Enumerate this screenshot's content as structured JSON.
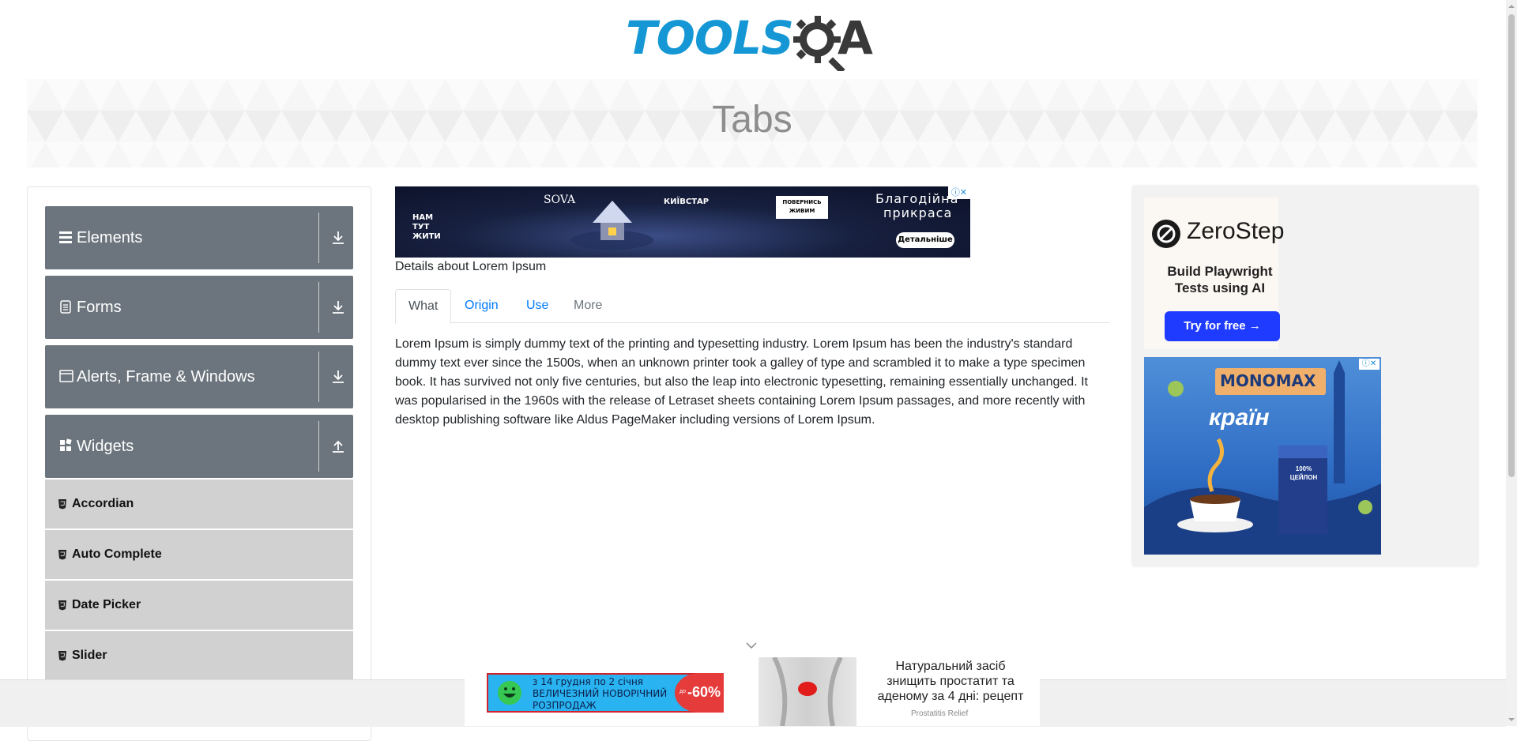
{
  "header": {
    "logo_text": "TOOLS",
    "logo_a": "A"
  },
  "banner": {
    "title": "Tabs"
  },
  "sidebar": {
    "groups": [
      {
        "label": "Elements",
        "icon": "hamburger-icon",
        "state": "collapsed"
      },
      {
        "label": "Forms",
        "icon": "form-icon",
        "state": "collapsed"
      },
      {
        "label": "Alerts, Frame & Windows",
        "icon": "window-icon",
        "state": "collapsed"
      },
      {
        "label": "Widgets",
        "icon": "widgets-icon",
        "state": "expanded"
      }
    ],
    "widgets_items": [
      {
        "label": "Accordian"
      },
      {
        "label": "Auto Complete"
      },
      {
        "label": "Date Picker"
      },
      {
        "label": "Slider"
      }
    ]
  },
  "ad_top": {
    "brand1": "SOVA",
    "brand2": "КИЇВСТАР",
    "badge": "ПОВЕРНИСЬ ЖИВИМ",
    "headline_line1": "Благодійна",
    "headline_line2": "прикраса",
    "cta": "Детальніше",
    "left_logo": "НАМ ТУТ ЖИТИ"
  },
  "main": {
    "details_title": "Details about Lorem Ipsum",
    "tabs": [
      {
        "label": "What",
        "state": "active"
      },
      {
        "label": "Origin",
        "state": "link"
      },
      {
        "label": "Use",
        "state": "link"
      },
      {
        "label": "More",
        "state": "disabled"
      }
    ],
    "content_lines": [
      "Lorem Ipsum is simply dummy text of the printing and typesetting industry. Lorem Ipsum has been the industry's standard",
      "dummy text ever since the 1500s, when an unknown printer took a galley of type and scrambled it to make a type specimen",
      "book. It has survived not only five centuries, but also the leap into electronic typesetting, remaining essentially unchanged. It",
      "was popularised in the 1960s with the release of Letraset sheets containing Lorem Ipsum passages, and more recently with",
      "desktop publishing software like Aldus PageMaker including versions of Lorem Ipsum."
    ]
  },
  "right_ad": {
    "zerostep_name": "ZeroStep",
    "zerostep_line1": "Build Playwright",
    "zerostep_line2": "Tests using AI",
    "zerostep_cta": "Try for free →",
    "mono_brand": "MONOMAX",
    "mono_word": "країн",
    "mono_pack": "100% ЦЕЙЛОН"
  },
  "bottom_ad": {
    "left_line1": "з 14 грудня по 2 січня",
    "left_line2": "ВЕЛИЧЕЗНИЙ НОВОРІЧНИЙ",
    "left_line3": "РОЗПРОДАЖ",
    "left_discount": "-60%",
    "left_prefix": "до",
    "right_text_1": "Натуральний засіб",
    "right_text_2": "знищить простатит та",
    "right_text_3": "аденому за 4 дні: рецепт",
    "right_source": "Prostatitis Relief"
  },
  "colors": {
    "logo_blue": "#1497d4",
    "sidebar_group": "#6c757d",
    "sidebar_item": "#d1d1d1",
    "tab_link": "#007bff",
    "zerostep_button": "#1f3bff"
  }
}
